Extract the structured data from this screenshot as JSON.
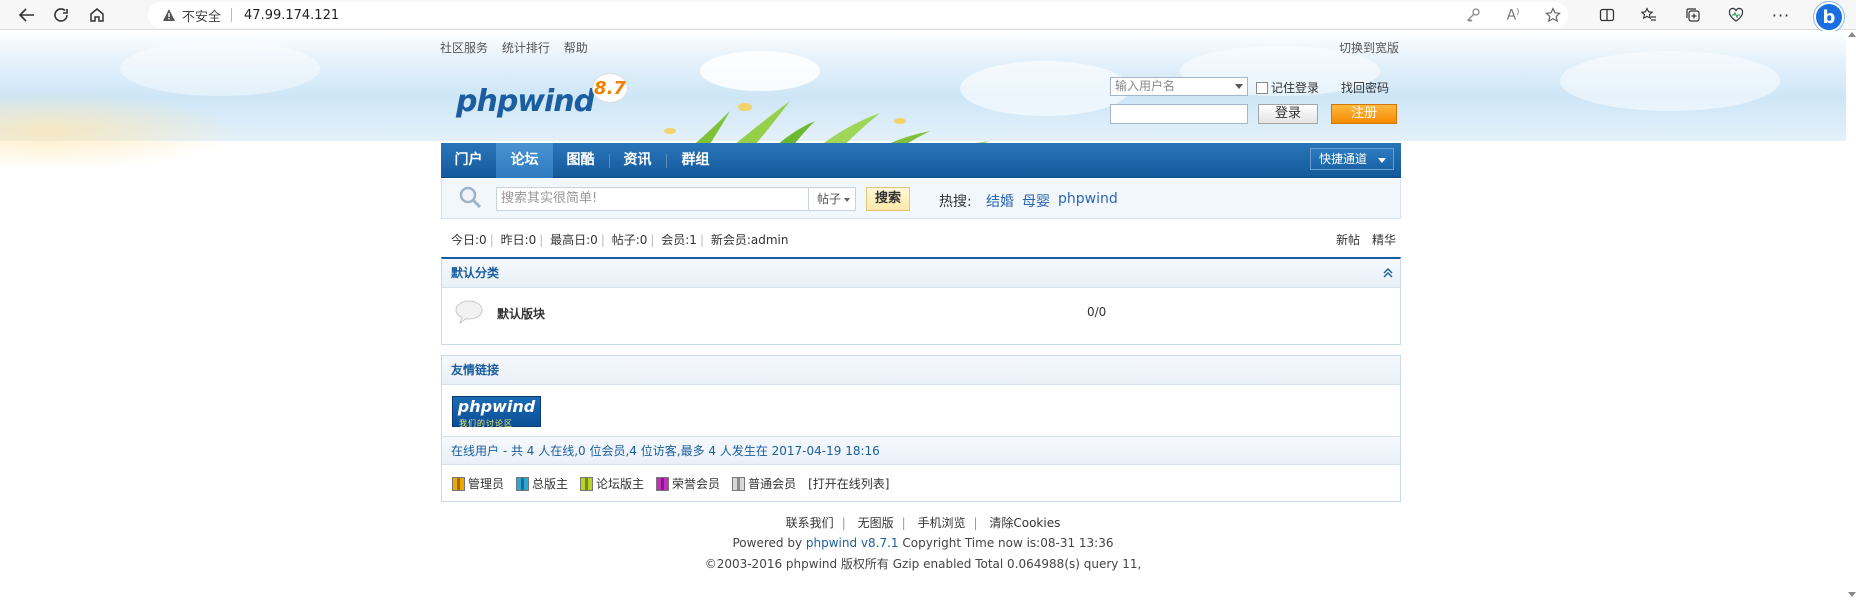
{
  "browser": {
    "insecure_label": "不安全",
    "url": "47.99.174.121"
  },
  "topnav": {
    "left": [
      "社区服务",
      "统计排行",
      "帮助"
    ],
    "right": "切换到宽版"
  },
  "logo": {
    "text": "phpwind",
    "version": "8.7"
  },
  "login": {
    "username_placeholder": "输入用户名",
    "remember_label": "记住登录",
    "forgot_label": "找回密码",
    "login_button": "登录",
    "register_button": "注册"
  },
  "mainnav": {
    "items": [
      "门户",
      "论坛",
      "图酷",
      "资讯",
      "群组"
    ],
    "active": "论坛",
    "quick_access": "快捷通道"
  },
  "search": {
    "placeholder": "搜索其实很简单!",
    "type": "帖子",
    "button": "搜索",
    "hot_label": "热搜:",
    "hot_terms": [
      "结婚",
      "母婴",
      "phpwind"
    ]
  },
  "stats": {
    "items": [
      "今日:0",
      "昨日:0",
      "最高日:0",
      "帖子:0",
      "会员:1",
      "新会员:admin"
    ],
    "right_links": [
      "新帖",
      "精华"
    ]
  },
  "category": {
    "title": "默认分类",
    "forums": [
      {
        "name": "默认版块",
        "count": "0/0"
      }
    ]
  },
  "links_panel": {
    "title": "友情链接",
    "logo_text": "phpwind",
    "logo_subtext": "我们的讨论区"
  },
  "online": {
    "text": "在线用户 - 共 4 人在线,0 位会员,4 位访客,最多 4 人发生在 2017-04-19 18:16"
  },
  "legend": {
    "items": [
      {
        "label": "管理员",
        "color": "#f0a800"
      },
      {
        "label": "总版主",
        "color": "#2aa8d8"
      },
      {
        "label": "论坛版主",
        "color": "#b8d428"
      },
      {
        "label": "荣誉会员",
        "color": "#c42ec0"
      },
      {
        "label": "普通会员",
        "color": "#d8d8d8"
      }
    ],
    "open_list": "[打开在线列表]"
  },
  "footer": {
    "links": [
      "联系我们",
      "无图版",
      "手机浏览",
      "清除Cookies"
    ],
    "powered_prefix": "Powered by",
    "powered_link": "phpwind v8.7.1",
    "time_text": "Copyright Time now is:08-31 13:36",
    "copyright": "©2003-2016 phpwind 版权所有 Gzip enabled Total 0.064988(s) query 11,"
  }
}
